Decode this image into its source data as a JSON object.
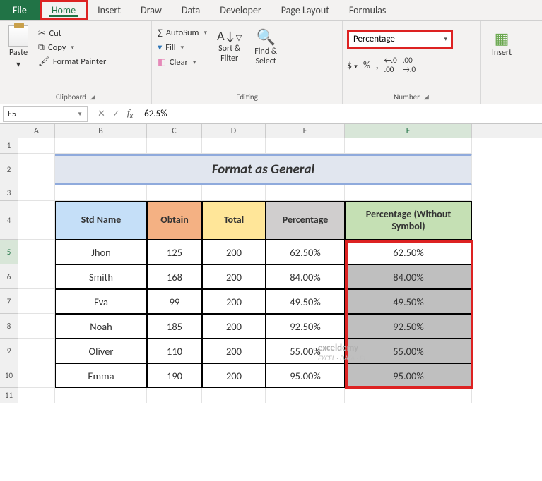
{
  "tabs": {
    "file": "File",
    "home": "Home",
    "insert": "Insert",
    "draw": "Draw",
    "data": "Data",
    "developer": "Developer",
    "pagelayout": "Page Layout",
    "formulas": "Formulas"
  },
  "clipboard": {
    "paste": "Paste",
    "cut": "Cut",
    "copy": "Copy",
    "fmtpainter": "Format Painter",
    "group": "Clipboard"
  },
  "editing": {
    "autosum": "AutoSum",
    "fill": "Fill",
    "clear": "Clear",
    "sortfilter": "Sort &\nFilter",
    "findselect": "Find &\nSelect",
    "group": "Editing"
  },
  "number": {
    "format": "Percentage",
    "dollar": "$",
    "percent": "%",
    "comma": ",",
    "incdec": ".00",
    "group": "Number"
  },
  "insertGroup": {
    "insert": "Insert"
  },
  "fx": {
    "cellref": "F5",
    "value": "62.5%"
  },
  "cols": {
    "A": "A",
    "B": "B",
    "C": "C",
    "D": "D",
    "E": "E",
    "F": "F"
  },
  "title": "Format as General",
  "headers": {
    "b": "Std Name",
    "c": "Obtain",
    "d": "Total",
    "e": "Percentage",
    "f": "Percentage (Without Symbol)"
  },
  "chart_data": {
    "type": "table",
    "columns": [
      "Std Name",
      "Obtain",
      "Total",
      "Percentage",
      "Percentage (Without Symbol)"
    ],
    "rows": [
      {
        "name": "Jhon",
        "obtain": 125,
        "total": 200,
        "pct": "62.50%",
        "pct_ns": "62.50%"
      },
      {
        "name": "Smith",
        "obtain": 168,
        "total": 200,
        "pct": "84.00%",
        "pct_ns": "84.00%"
      },
      {
        "name": "Eva",
        "obtain": 99,
        "total": 200,
        "pct": "49.50%",
        "pct_ns": "49.50%"
      },
      {
        "name": "Noah",
        "obtain": 185,
        "total": 200,
        "pct": "92.50%",
        "pct_ns": "92.50%"
      },
      {
        "name": "Oliver",
        "obtain": 110,
        "total": 200,
        "pct": "55.00%",
        "pct_ns": "55.00%"
      },
      {
        "name": "Emma",
        "obtain": 190,
        "total": 200,
        "pct": "95.00%",
        "pct_ns": "95.00%"
      }
    ]
  },
  "rownums": [
    "1",
    "2",
    "3",
    "4",
    "5",
    "6",
    "7",
    "8",
    "9",
    "10",
    "11"
  ],
  "watermark": {
    "brand": "exceldemy",
    "tagline": "EXCEL · DATA · BI"
  }
}
